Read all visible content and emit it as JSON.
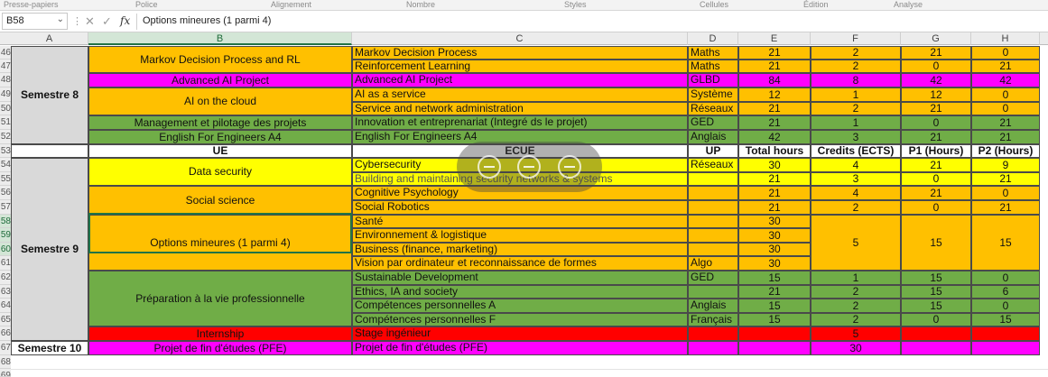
{
  "ribbon": {
    "groups": [
      "Presse-papiers",
      "Police",
      "Alignement",
      "Nombre",
      "Styles",
      "Cellules",
      "Édition",
      "Analyse"
    ]
  },
  "formula_bar": {
    "name_box": "B58",
    "formula": "Options mineures (1 parmi 4)",
    "fx": "fx",
    "cancel": "✕",
    "confirm": "✓"
  },
  "columns": [
    "A",
    "B",
    "C",
    "D",
    "E",
    "F",
    "G",
    "H"
  ],
  "rows": [
    "46",
    "47",
    "48",
    "49",
    "50",
    "51",
    "52",
    "53",
    "54",
    "55",
    "56",
    "57",
    "58",
    "59",
    "60",
    "61",
    "62",
    "63",
    "64",
    "65",
    "66",
    "67",
    "68",
    "69"
  ],
  "semesters": {
    "s8": "Semestre 8",
    "s9": "Semestre 9",
    "s10": "Semestre 10"
  },
  "ue": {
    "mdp_rl": "Markov Decision Process and RL",
    "aai": "Advanced AI Project",
    "ai_cloud": "AI on the cloud",
    "mgmt": "Management et pilotage des projets",
    "english": "English For Engineers A4",
    "data_sec": "Data security",
    "social": "Social science",
    "options": "Options mineures (1 parmi 4)",
    "prep": "Préparation à la vie professionnelle",
    "intern": "Internship",
    "pfe": "Projet de fin d'études (PFE)"
  },
  "header": {
    "ue": "UE",
    "ecue": "ECUE",
    "up": "UP",
    "total": "Total hours",
    "credits": "Credits (ECTS)",
    "p1": "P1 (Hours)",
    "p2": "P2 (Hours)"
  },
  "ecue": {
    "r46": {
      "name": "Markov Decision Process",
      "up": "Maths",
      "total": "21",
      "credits": "2",
      "p1": "21",
      "p2": "0"
    },
    "r47": {
      "name": "Reinforcement Learning",
      "up": "Maths",
      "total": "21",
      "credits": "2",
      "p1": "0",
      "p2": "21"
    },
    "r48": {
      "name": "Advanced AI Project",
      "up": "GLBD",
      "total": "84",
      "credits": "8",
      "p1": "42",
      "p2": "42"
    },
    "r49": {
      "name": "AI as a service",
      "up": "Système",
      "total": "12",
      "credits": "1",
      "p1": "12",
      "p2": "0"
    },
    "r50": {
      "name": "Service and network administration",
      "up": "Réseaux",
      "total": "21",
      "credits": "2",
      "p1": "21",
      "p2": "0"
    },
    "r51": {
      "name": "Innovation et entreprenariat (Integré ds le projet)",
      "up": "GED",
      "total": "21",
      "credits": "1",
      "p1": "0",
      "p2": "21"
    },
    "r52": {
      "name": "English For Engineers A4",
      "up": "Anglais",
      "total": "42",
      "credits": "3",
      "p1": "21",
      "p2": "21"
    },
    "r54": {
      "name": "Cybersecurity",
      "up": "Réseaux",
      "total": "30",
      "credits": "4",
      "p1": "21",
      "p2": "9"
    },
    "r55": {
      "name": "Building and maintaining security networks & systems",
      "up": "",
      "total": "21",
      "credits": "3",
      "p1": "0",
      "p2": "21"
    },
    "r56": {
      "name": "Cognitive Psychology",
      "up": "",
      "total": "21",
      "credits": "4",
      "p1": "21",
      "p2": "0"
    },
    "r57": {
      "name": "Social Robotics",
      "up": "",
      "total": "21",
      "credits": "2",
      "p1": "0",
      "p2": "21"
    },
    "r58": {
      "name": "Santé",
      "total": "30"
    },
    "r59": {
      "name": "Environnement & logistique",
      "total": "30"
    },
    "r60": {
      "name": "Business (finance, marketing)",
      "total": "30"
    },
    "r61": {
      "name": "Vision par ordinateur et reconnaissance de formes",
      "up": "Algo",
      "total": "30"
    },
    "opt": {
      "credits": "5",
      "p1": "15",
      "p2": "15"
    },
    "r62": {
      "name": "Sustainable Development",
      "up": "GED",
      "total": "15",
      "credits": "1",
      "p1": "15",
      "p2": "0"
    },
    "r63": {
      "name": "Ethics, IA and society",
      "up": "",
      "total": "21",
      "credits": "2",
      "p1": "15",
      "p2": "6"
    },
    "r64": {
      "name": "Compétences personnelles A",
      "up": "Anglais",
      "total": "15",
      "credits": "2",
      "p1": "15",
      "p2": "0"
    },
    "r65": {
      "name": "Compétences personnelles F",
      "up": "Français",
      "total": "15",
      "credits": "2",
      "p1": "0",
      "p2": "15"
    },
    "r66": {
      "name": "Stage ingénieur",
      "credits": "5"
    },
    "r67": {
      "name": "Projet de fin d'études (PFE)",
      "credits": "30"
    }
  }
}
